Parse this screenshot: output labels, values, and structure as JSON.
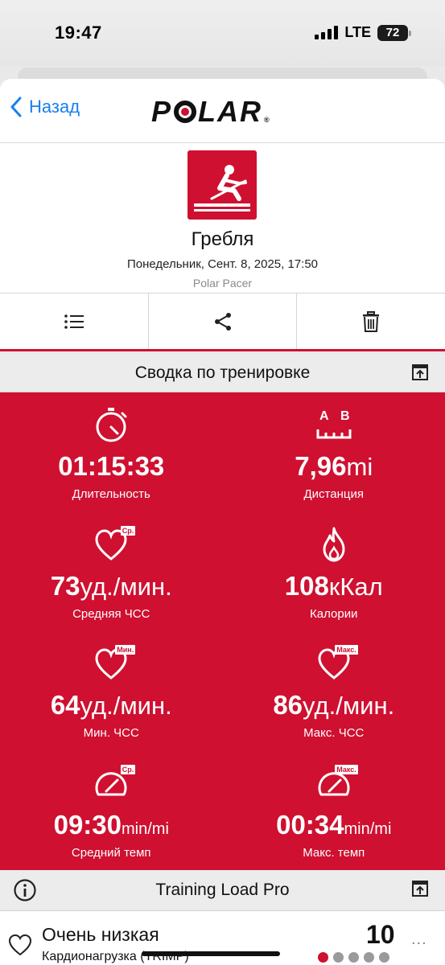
{
  "status_bar": {
    "time": "19:47",
    "network": "LTE",
    "battery": "72"
  },
  "header": {
    "back_label": "Назад",
    "logo_text": "POLAR",
    "logo_registered": "®"
  },
  "workout": {
    "sport": "Гребля",
    "datetime": "Понедельник, Сент. 8, 2025, 17:50",
    "device": "Polar Pacer",
    "sport_icon": "rowing-icon"
  },
  "actions": [
    {
      "icon": "list-icon"
    },
    {
      "icon": "share-icon"
    },
    {
      "icon": "trash-icon"
    }
  ],
  "summary": {
    "title": "Сводка по тренировке",
    "stats": [
      {
        "icon": "stopwatch-icon",
        "value": "01:15:33",
        "unit": "",
        "label": "Длительность"
      },
      {
        "icon": "distance-icon",
        "icon_text_a": "A",
        "icon_text_b": "B",
        "value": "7,96",
        "unit": "mi",
        "label": "Дистанция"
      },
      {
        "icon": "heart-icon",
        "badge": "Ср.",
        "value": "73",
        "unit": "уд./мин.",
        "label": "Средняя ЧСС"
      },
      {
        "icon": "flame-icon",
        "value": "108",
        "unit": "кКал",
        "label": "Калории"
      },
      {
        "icon": "heart-icon",
        "badge": "Мин.",
        "value": "64",
        "unit": "уд./мин.",
        "label": "Мин. ЧСС"
      },
      {
        "icon": "heart-icon",
        "badge": "Макс.",
        "value": "86",
        "unit": "уд./мин.",
        "label": "Макс. ЧСС"
      },
      {
        "icon": "speedometer-icon",
        "badge": "Ср.",
        "value": "09:30",
        "unit": "min/mi",
        "label": "Средний темп"
      },
      {
        "icon": "speedometer-icon",
        "badge": "Макс.",
        "value": "00:34",
        "unit": "min/mi",
        "label": "Макс. темп"
      }
    ]
  },
  "training_load": {
    "title": "Training Load Pro",
    "level_text": "Очень низкая",
    "metric": "Кардионагрузка (TRIMP)",
    "score": "10",
    "more": "...",
    "level_indicator": {
      "level": 1,
      "of": 5
    }
  },
  "colors": {
    "accent": "#cf1030",
    "link": "#1a7ff0",
    "section_bg": "#ececec"
  }
}
